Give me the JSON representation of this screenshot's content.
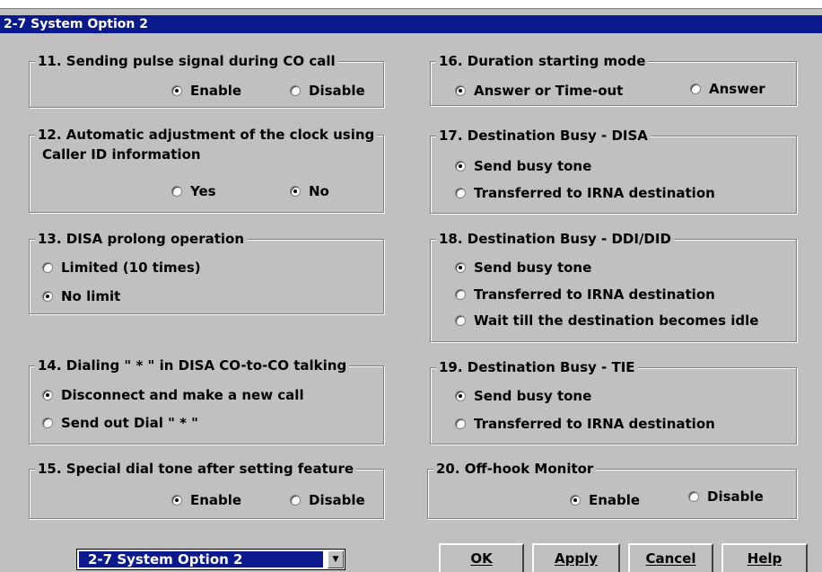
{
  "window": {
    "title": "2-7 System Option 2"
  },
  "groups": {
    "g11": {
      "title": "11. Sending pulse signal during CO call",
      "options": [
        "Enable",
        "Disable"
      ],
      "selected": "Enable"
    },
    "g12": {
      "title": "12. Automatic adjustment of the clock using",
      "subtitle": "Caller ID information",
      "options": [
        "Yes",
        "No"
      ],
      "selected": "No"
    },
    "g13": {
      "title": "13. DISA prolong operation",
      "options": [
        "Limited (10 times)",
        "No limit"
      ],
      "selected": "No limit"
    },
    "g14": {
      "title": "14. Dialing \" * \" in DISA CO-to-CO talking",
      "options": [
        "Disconnect and make a new call",
        "Send out Dial \" * \""
      ],
      "selected": "Disconnect and make a new call"
    },
    "g15": {
      "title": "15. Special dial tone after setting feature",
      "options": [
        "Enable",
        "Disable"
      ],
      "selected": "Enable"
    },
    "g16": {
      "title": "16. Duration starting mode",
      "options": [
        "Answer or Time-out",
        "Answer"
      ],
      "selected": "Answer or Time-out"
    },
    "g17": {
      "title": "17. Destination Busy - DISA",
      "options": [
        "Send busy tone",
        "Transferred to IRNA destination"
      ],
      "selected": "Send busy tone"
    },
    "g18": {
      "title": "18. Destination Busy - DDI/DID",
      "options": [
        "Send busy tone",
        "Transferred to IRNA destination",
        "Wait till the destination becomes idle"
      ],
      "selected": "Send busy tone"
    },
    "g19": {
      "title": "19. Destination Busy - TIE",
      "options": [
        "Send busy tone",
        "Transferred to IRNA destination"
      ],
      "selected": "Send busy tone"
    },
    "g20": {
      "title": "20. Off-hook Monitor",
      "options": [
        "Enable",
        "Disable"
      ],
      "selected": "Enable"
    }
  },
  "footer": {
    "page_select": "2-7 System Option 2",
    "ok_label": "OK",
    "apply_label": "Apply",
    "cancel_label": "Cancel",
    "help_label": "Help"
  }
}
